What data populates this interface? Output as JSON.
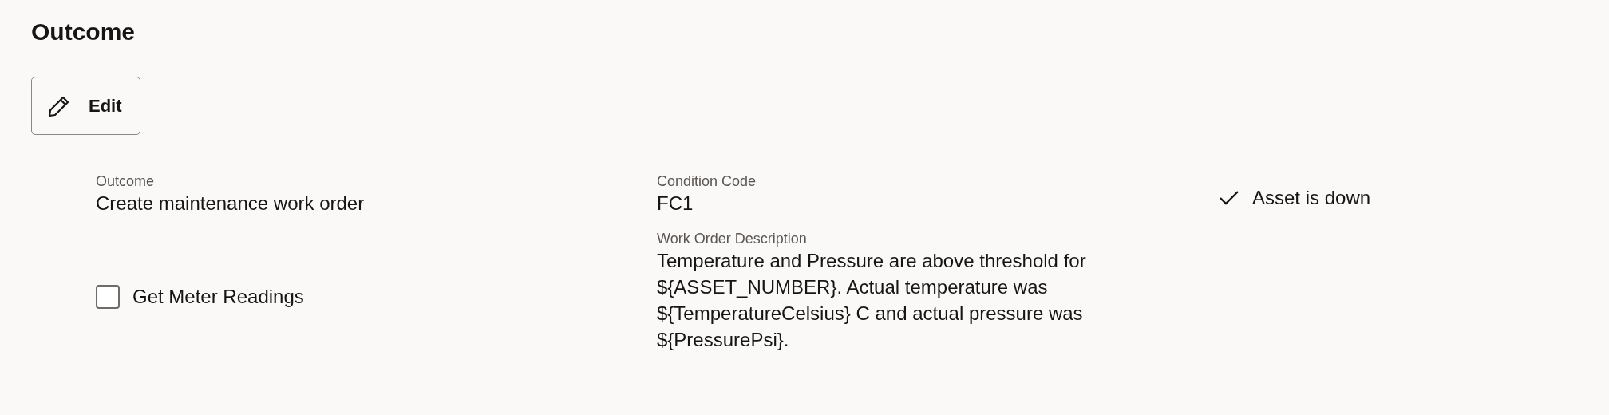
{
  "section": {
    "title": "Outcome"
  },
  "edit_button": {
    "label": "Edit"
  },
  "fields": [
    {
      "kind": "value",
      "label": "Outcome",
      "value": "Create maintenance work order"
    },
    {
      "kind": "value",
      "label": "Condition Code",
      "value": "FC1"
    },
    {
      "kind": "flag",
      "label": "Asset is down",
      "checked": true
    },
    {
      "kind": "checkbox",
      "label": "Get Meter Readings",
      "checked": false
    },
    {
      "kind": "value",
      "label": "Work Order Description",
      "value": "Temperature and Pressure are above threshold for ${ASSET_NUMBER}. Actual temperature was ${TemperatureCelsius} C and actual pressure was ${PressurePsi}."
    }
  ]
}
